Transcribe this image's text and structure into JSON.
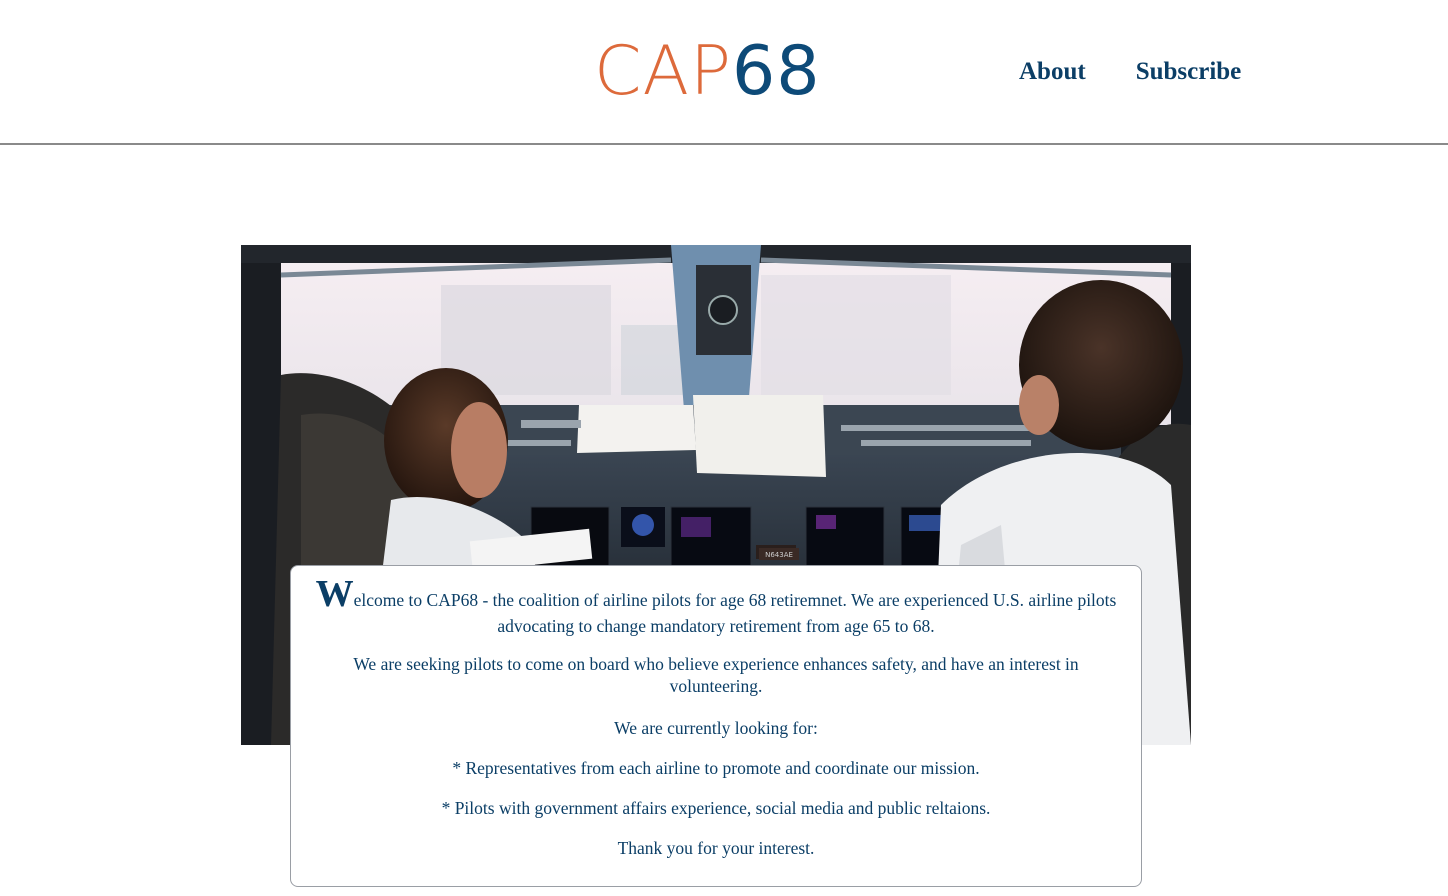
{
  "header": {
    "logo_text_primary": "CAP",
    "logo_text_secondary": "68",
    "nav": [
      {
        "label": "About"
      },
      {
        "label": "Subscribe"
      }
    ]
  },
  "hero": {
    "image_name": "cockpit-photo",
    "registration_text": "N643AE"
  },
  "intro": {
    "dropcap": "W",
    "welcome_rest": "elcome to CAP68 - the coalition of airline pilots for age 68 retiremnet. We are experienced U.S. airline pilots advocating to change mandatory retirement from age 65 to 68.",
    "seeking": "We are seeking pilots to come on board who believe experience enhances safety, and have an interest in volunteering.",
    "looking": "We are currently looking for:",
    "item1": "* Representatives from each airline to promote and coordinate our mission.",
    "item2": "* Pilots with government affairs experience, social media and public reltaions.",
    "thanks": "Thank you for your interest."
  },
  "colors": {
    "brand_orange": "#dd6a3b",
    "brand_blue": "#0d4a78",
    "text_blue": "#0b3e66"
  }
}
